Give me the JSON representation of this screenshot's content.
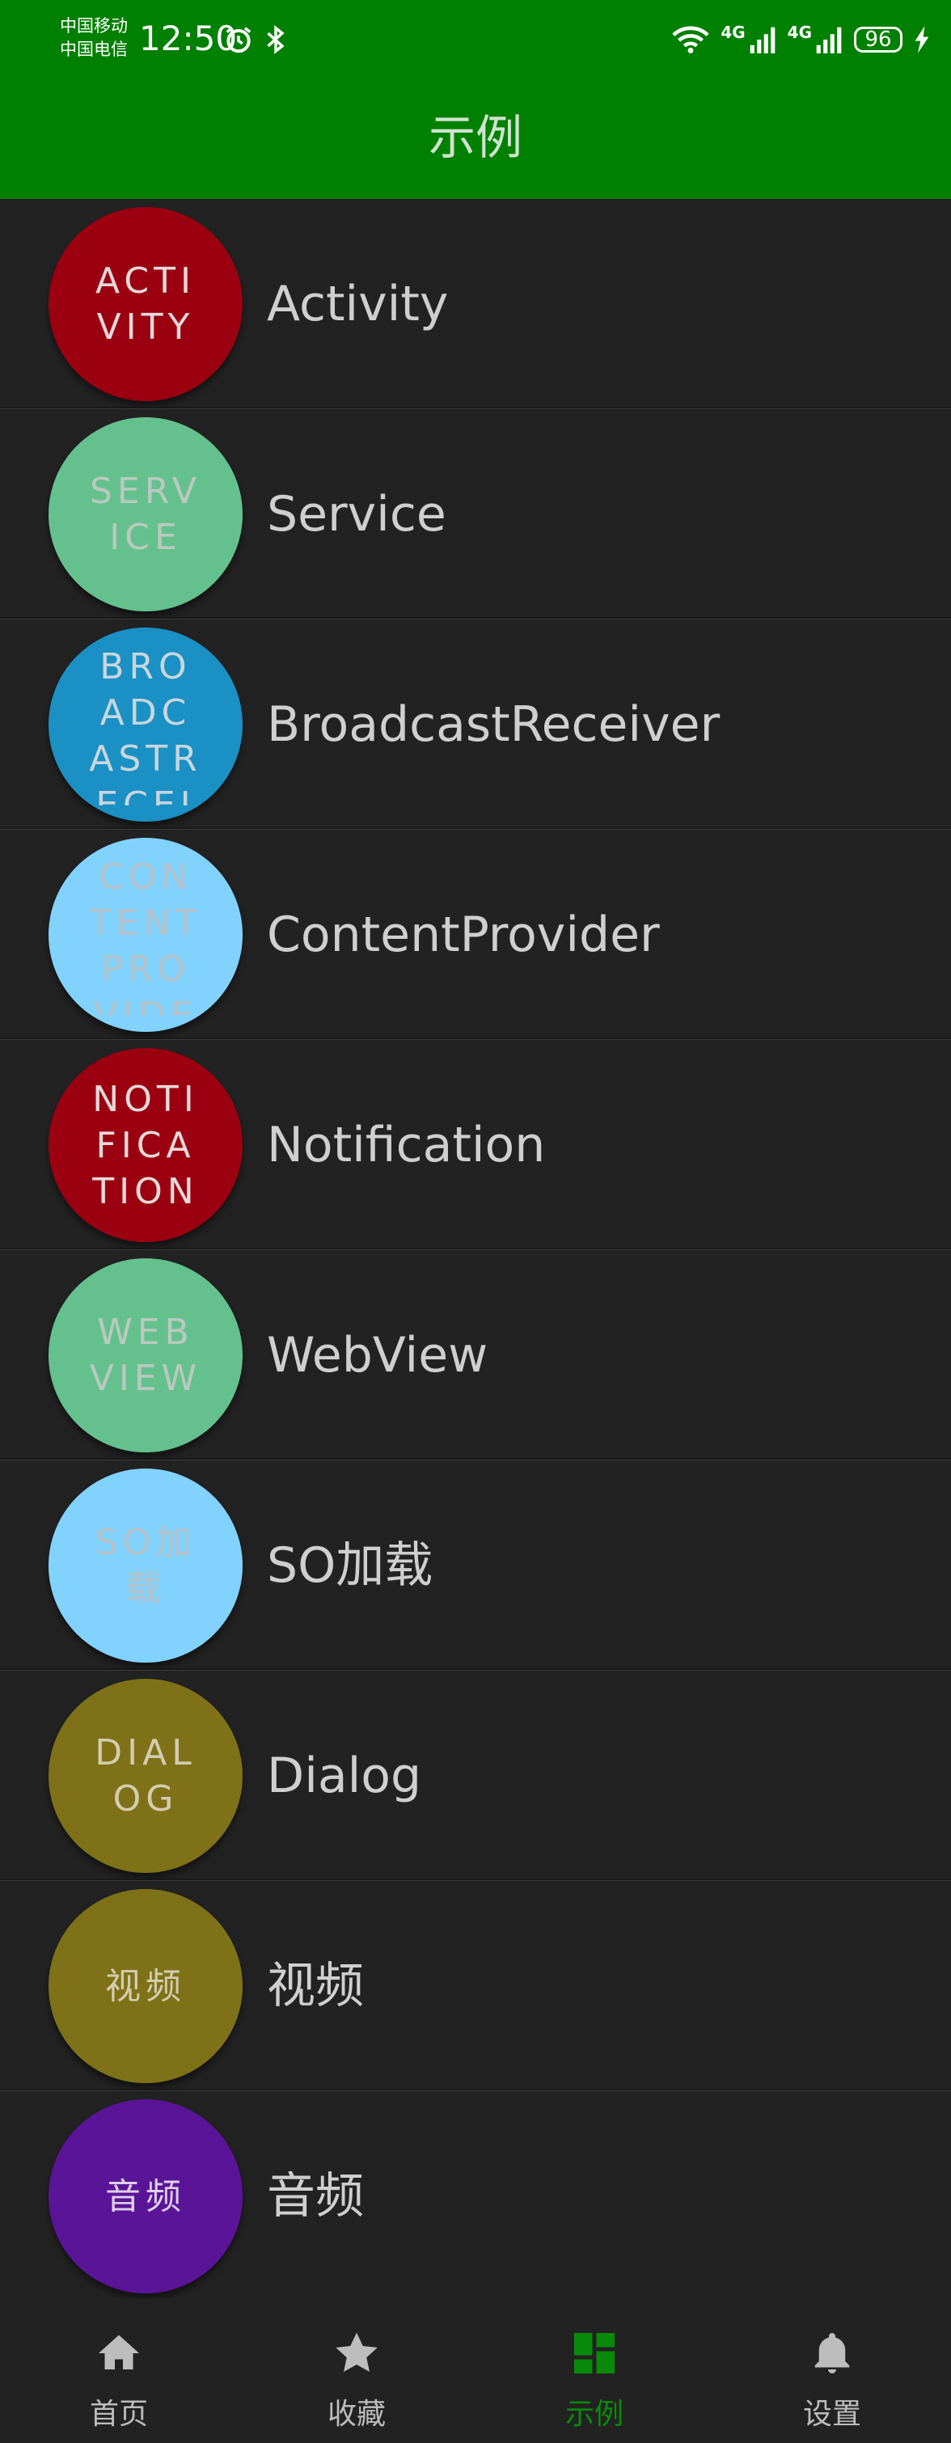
{
  "status_bar": {
    "carrier_1": "中国移动",
    "carrier_2": "中国电信",
    "time": "12:50",
    "network_1": "4G",
    "network_2": "4G",
    "battery": "96"
  },
  "header": {
    "title": "示例"
  },
  "list": {
    "items": [
      {
        "avatar_text": "ACTIVITY",
        "label": "Activity",
        "color": "#9a0010",
        "text_color": "#e6d9d9"
      },
      {
        "avatar_text": "SERVICE",
        "label": "Service",
        "color": "#64c18e",
        "text_color": "#b9c9bf"
      },
      {
        "avatar_text": "BROADCASTRECEIVER",
        "label": "BroadcastReceiver",
        "color": "#1a90c4",
        "text_color": "#c7d6de"
      },
      {
        "avatar_text": "CONTENTPROVIDER",
        "label": "ContentProvider",
        "color": "#82d2fe",
        "text_color": "#b5c2c9"
      },
      {
        "avatar_text": "NOTIFICATION",
        "label": "Notification",
        "color": "#9a0010",
        "text_color": "#e6d9d9"
      },
      {
        "avatar_text": "WEBVIEW",
        "label": "WebView",
        "color": "#64c18e",
        "text_color": "#b9c9bf"
      },
      {
        "avatar_text": "SO加载",
        "label": "SO加载",
        "color": "#82d2fe",
        "text_color": "#b5c2c9"
      },
      {
        "avatar_text": "DIALOG",
        "label": "Dialog",
        "color": "#7e7118",
        "text_color": "#d3cdaf"
      },
      {
        "avatar_text": "视频",
        "label": "视频",
        "color": "#7e7118",
        "text_color": "#d3cdaf"
      },
      {
        "avatar_text": "音频",
        "label": "音频",
        "color": "#5a1498",
        "text_color": "#ddd0e8"
      }
    ]
  },
  "bottom_nav": {
    "items": [
      {
        "label": "首页",
        "icon": "home-icon"
      },
      {
        "label": "收藏",
        "icon": "star-icon"
      },
      {
        "label": "示例",
        "icon": "dashboard-icon",
        "active": true
      },
      {
        "label": "设置",
        "icon": "bell-icon"
      }
    ],
    "active_color": "#0a8a0a",
    "inactive_color": "#bdbdbd"
  }
}
